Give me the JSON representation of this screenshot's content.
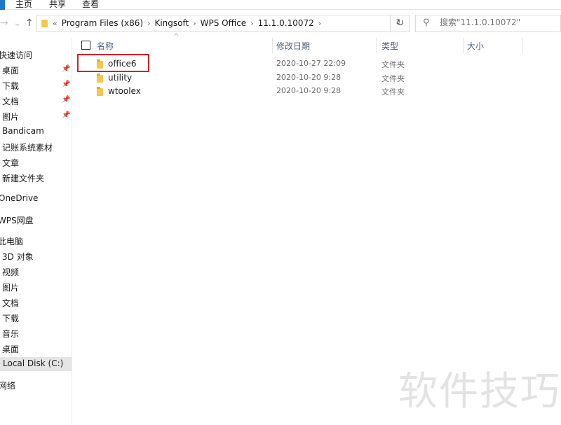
{
  "ribbon": {
    "tabs": [
      "主页",
      "共享",
      "查看"
    ]
  },
  "address_bar": {
    "crumbs": [
      "Program Files (x86)",
      "Kingsoft",
      "WPS Office",
      "11.1.0.10072"
    ],
    "search_placeholder": "搜索\"11.1.0.10072\""
  },
  "nav_pane": {
    "items": [
      {
        "label": "快速访问",
        "pinned": false
      },
      {
        "label": "桌面",
        "pinned": true
      },
      {
        "label": "下载",
        "pinned": true
      },
      {
        "label": "文档",
        "pinned": true
      },
      {
        "label": "图片",
        "pinned": true
      },
      {
        "label": "Bandicam",
        "pinned": false
      },
      {
        "label": "记账系统素材",
        "pinned": false
      },
      {
        "label": "文章",
        "pinned": false
      },
      {
        "label": "新建文件夹",
        "pinned": false
      },
      {
        "label": "OneDrive",
        "pinned": false
      },
      {
        "label": "WPS网盘",
        "pinned": false
      },
      {
        "label": "此电脑",
        "pinned": false
      },
      {
        "label": "3D 对象",
        "pinned": false
      },
      {
        "label": "视频",
        "pinned": false
      },
      {
        "label": "图片",
        "pinned": false
      },
      {
        "label": "文档",
        "pinned": false
      },
      {
        "label": "下载",
        "pinned": false
      },
      {
        "label": "音乐",
        "pinned": false
      },
      {
        "label": "桌面",
        "pinned": false
      },
      {
        "label": "Local Disk (C:)",
        "pinned": false,
        "selected": true
      },
      {
        "label": "网络",
        "pinned": false
      }
    ]
  },
  "columns": {
    "name": "名称",
    "modified": "修改日期",
    "type": "类型",
    "size": "大小"
  },
  "files": [
    {
      "name": "office6",
      "modified": "2020-10-27 22:09",
      "type": "文件夹",
      "highlighted": true
    },
    {
      "name": "utility",
      "modified": "2020-10-20 9:28",
      "type": "文件夹"
    },
    {
      "name": "wtoolex",
      "modified": "2020-10-20 9:28",
      "type": "文件夹"
    }
  ],
  "watermark": "软件技巧",
  "colors": {
    "accent": "#1979ca",
    "highlight": "#d61f26",
    "folder": "#f3c84b"
  }
}
